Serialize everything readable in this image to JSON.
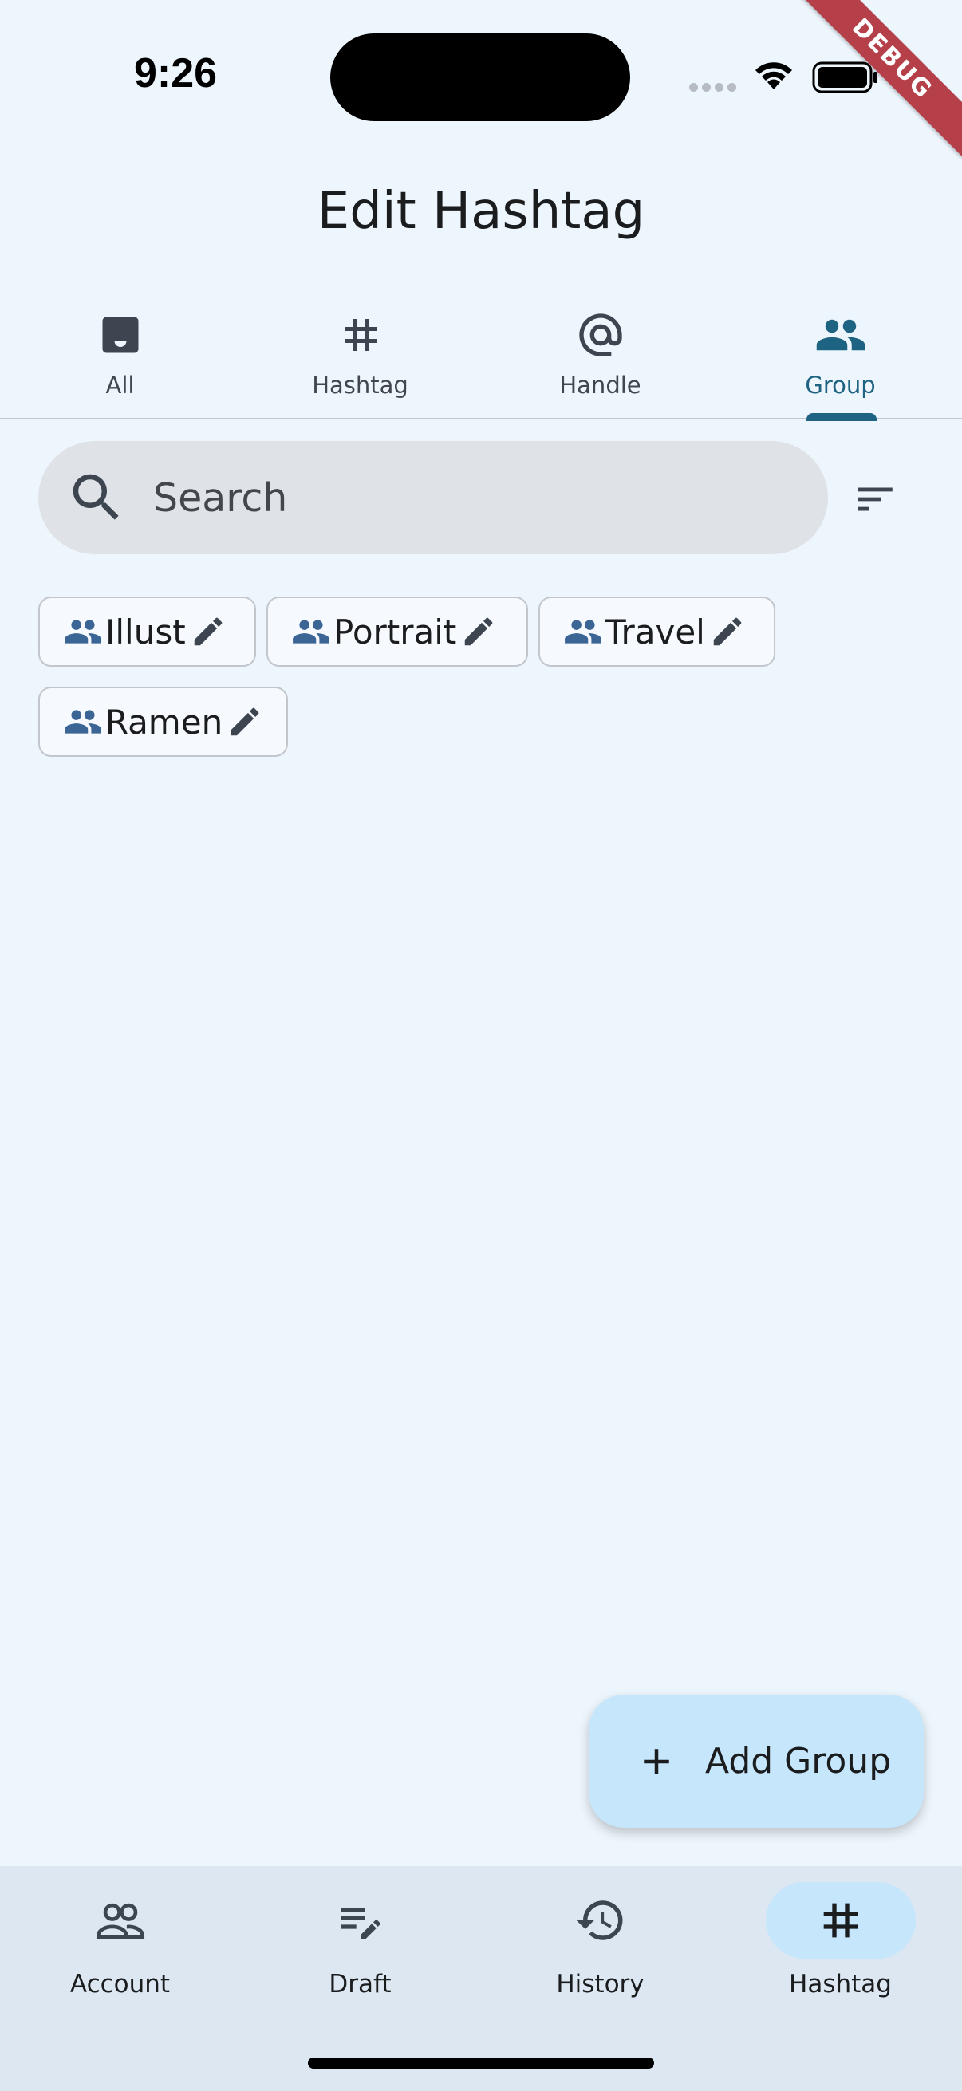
{
  "status_bar": {
    "time": "9:26",
    "debug_label": "DEBUG"
  },
  "page": {
    "title": "Edit Hashtag"
  },
  "tabs": [
    {
      "label": "All",
      "icon": "inbox-icon",
      "active": false
    },
    {
      "label": "Hashtag",
      "icon": "hashtag-icon",
      "active": false
    },
    {
      "label": "Handle",
      "icon": "at-sign-icon",
      "active": false
    },
    {
      "label": "Group",
      "icon": "group-icon",
      "active": true
    }
  ],
  "search": {
    "placeholder": "Search",
    "value": ""
  },
  "groups": [
    {
      "label": "Illust"
    },
    {
      "label": "Portrait"
    },
    {
      "label": "Travel"
    },
    {
      "label": "Ramen"
    }
  ],
  "fab": {
    "label": "Add Group",
    "icon": "plus-icon"
  },
  "bottom_nav": [
    {
      "label": "Account",
      "icon": "people-outline-icon",
      "active": false
    },
    {
      "label": "Draft",
      "icon": "edit-note-icon",
      "active": false
    },
    {
      "label": "History",
      "icon": "history-icon",
      "active": false
    },
    {
      "label": "Hashtag",
      "icon": "hashtag-icon",
      "active": true
    }
  ],
  "colors": {
    "background": "#eef6fd",
    "accent": "#1f6382",
    "chip_icon": "#3a6594",
    "fab_background": "#c6e6fc",
    "nav_background": "#dce7f1",
    "debug_ribbon": "#b6404a"
  }
}
